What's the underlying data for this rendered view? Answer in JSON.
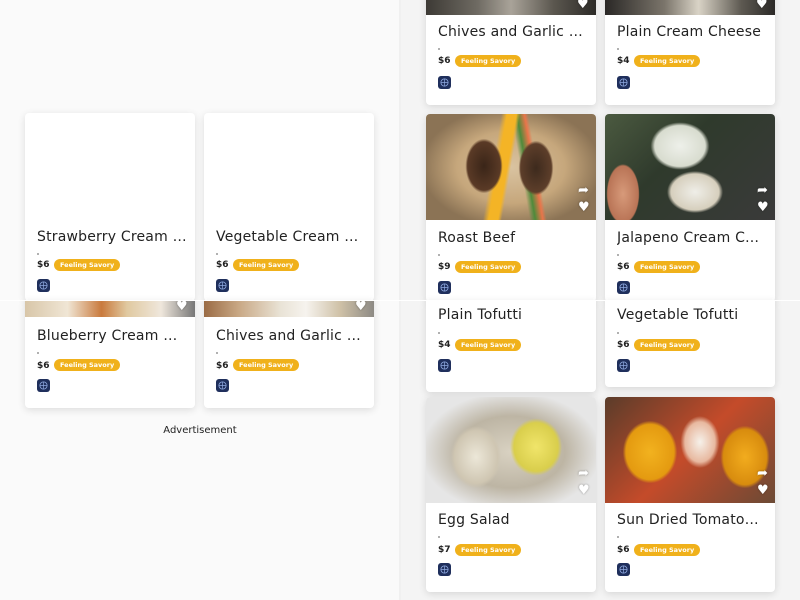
{
  "tag_label": "Feeling Savory",
  "ad_label": "Advertisement",
  "colors": {
    "tag": "#f0b11b",
    "brand": "#1f2f5c"
  },
  "left_cards": [
    {
      "title": "Strawberry Cream C...",
      "price": "$6"
    },
    {
      "title": "Vegetable Cream C...",
      "price": "$6"
    },
    {
      "title": "Blueberry Cream Ch...",
      "price": "$6"
    },
    {
      "title": "Chives and Garlic To...",
      "price": "$6"
    }
  ],
  "right_cards": [
    {
      "title": "Chives and Garlic Cr...",
      "price": "$6"
    },
    {
      "title": "Plain Cream Cheese",
      "price": "$4"
    },
    {
      "title": "Roast Beef",
      "price": "$9"
    },
    {
      "title": "Jalapeno Cream Che...",
      "price": "$6"
    },
    {
      "title": "Plain Tofutti",
      "price": "$4"
    },
    {
      "title": "Vegetable Tofutti",
      "price": "$6"
    },
    {
      "title": "Egg Salad",
      "price": "$7"
    },
    {
      "title": "Sun Dried Tomatoes...",
      "price": "$6"
    }
  ]
}
